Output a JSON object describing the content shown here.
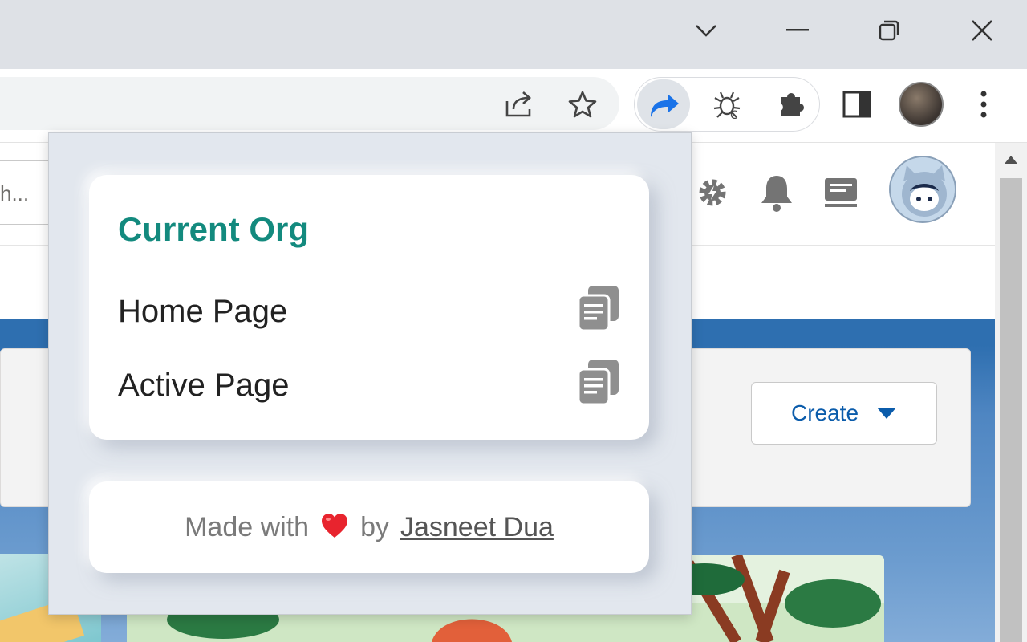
{
  "browser": {
    "window_controls": [
      "tab-search",
      "minimize",
      "restore",
      "close"
    ],
    "toolbar_icons": [
      "share-icon",
      "bookmark-star-icon",
      "redirect-extension-icon",
      "bug-extension-icon",
      "extensions-puzzle-icon",
      "side-panel-icon",
      "profile-avatar",
      "menu-dots-icon"
    ]
  },
  "salesforce": {
    "search_placeholder": "h...",
    "header_icons": [
      "setup-gear-icon",
      "notifications-bell-icon",
      "feedback-icon"
    ],
    "create_button": "Create"
  },
  "popup": {
    "title": "Current Org",
    "rows": [
      {
        "label": "Home Page"
      },
      {
        "label": "Active Page"
      }
    ],
    "footer": {
      "prefix": "Made with",
      "heart": "❤",
      "by": "by",
      "author": "Jasneet Dua"
    }
  },
  "colors": {
    "title_accent": "#138a7e",
    "heart": "#e8242e",
    "create_text": "#0b5cab",
    "popup_bg": "#e2e7ee"
  }
}
